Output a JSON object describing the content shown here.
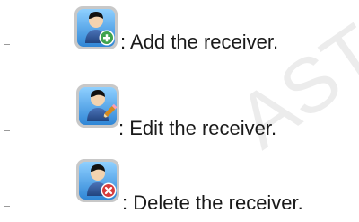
{
  "watermark": {
    "text": "ASTAR",
    "color": "#e9e9e9"
  },
  "items": [
    {
      "bullet": "–",
      "icon": "user-add-icon",
      "label": ": Add the receiver.",
      "badge_color": "#3fa34d"
    },
    {
      "bullet": "–",
      "icon": "user-edit-icon",
      "label": ": Edit the receiver.",
      "badge_color": "#d48a1f"
    },
    {
      "bullet": "–",
      "icon": "user-delete-icon",
      "label": ": Delete the receiver.",
      "badge_color": "#d63c3c"
    }
  ]
}
